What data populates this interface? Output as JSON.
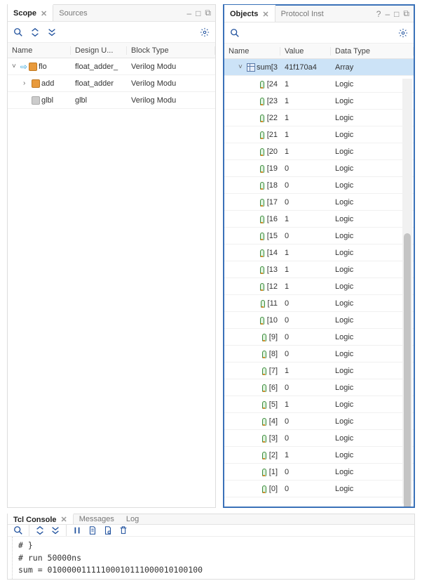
{
  "scope": {
    "tabs": {
      "active": "Scope",
      "inactive": "Sources"
    },
    "columns": {
      "c1": "Name",
      "c2": "Design U...",
      "c3": "Block Type"
    },
    "rows": [
      {
        "indent": 0,
        "arrow": "v",
        "go": true,
        "icon": "mod",
        "name": "flo",
        "du": "float_adder_",
        "bt": "Verilog Modu"
      },
      {
        "indent": 1,
        "arrow": ">",
        "go": false,
        "icon": "mod",
        "name": "add",
        "du": "float_adder",
        "bt": "Verilog Modu"
      },
      {
        "indent": 1,
        "arrow": "",
        "go": false,
        "icon": "gray",
        "name": "glbl",
        "du": "glbl",
        "bt": "Verilog Modu"
      }
    ]
  },
  "objects": {
    "tabs": {
      "active": "Objects",
      "inactive": "Protocol Inst"
    },
    "columns": {
      "c1": "Name",
      "c2": "Value",
      "c3": "Data Type"
    },
    "root": {
      "name": "sum[3",
      "value": "41f170a4",
      "dtype": "Array"
    },
    "bits": [
      {
        "idx": "[24",
        "v": "1",
        "dt": "Logic"
      },
      {
        "idx": "[23",
        "v": "1",
        "dt": "Logic"
      },
      {
        "idx": "[22",
        "v": "1",
        "dt": "Logic"
      },
      {
        "idx": "[21",
        "v": "1",
        "dt": "Logic"
      },
      {
        "idx": "[20",
        "v": "1",
        "dt": "Logic"
      },
      {
        "idx": "[19",
        "v": "0",
        "dt": "Logic"
      },
      {
        "idx": "[18",
        "v": "0",
        "dt": "Logic"
      },
      {
        "idx": "[17",
        "v": "0",
        "dt": "Logic"
      },
      {
        "idx": "[16",
        "v": "1",
        "dt": "Logic"
      },
      {
        "idx": "[15",
        "v": "0",
        "dt": "Logic"
      },
      {
        "idx": "[14",
        "v": "1",
        "dt": "Logic"
      },
      {
        "idx": "[13",
        "v": "1",
        "dt": "Logic"
      },
      {
        "idx": "[12",
        "v": "1",
        "dt": "Logic"
      },
      {
        "idx": "[11",
        "v": "0",
        "dt": "Logic"
      },
      {
        "idx": "[10",
        "v": "0",
        "dt": "Logic"
      },
      {
        "idx": "[9]",
        "v": "0",
        "dt": "Logic"
      },
      {
        "idx": "[8]",
        "v": "0",
        "dt": "Logic"
      },
      {
        "idx": "[7]",
        "v": "1",
        "dt": "Logic"
      },
      {
        "idx": "[6]",
        "v": "0",
        "dt": "Logic"
      },
      {
        "idx": "[5]",
        "v": "1",
        "dt": "Logic"
      },
      {
        "idx": "[4]",
        "v": "0",
        "dt": "Logic"
      },
      {
        "idx": "[3]",
        "v": "0",
        "dt": "Logic"
      },
      {
        "idx": "[2]",
        "v": "1",
        "dt": "Logic"
      },
      {
        "idx": "[1]",
        "v": "0",
        "dt": "Logic"
      },
      {
        "idx": "[0]",
        "v": "0",
        "dt": "Logic"
      }
    ]
  },
  "console": {
    "tabs": {
      "active": "Tcl Console",
      "t2": "Messages",
      "t3": "Log"
    },
    "lines": [
      "# }",
      "# run 50000ns",
      "sum = 01000001111100010111000010100100"
    ]
  },
  "win": {
    "help": "?",
    "min": "–",
    "max": "□",
    "pop": "⧉"
  }
}
